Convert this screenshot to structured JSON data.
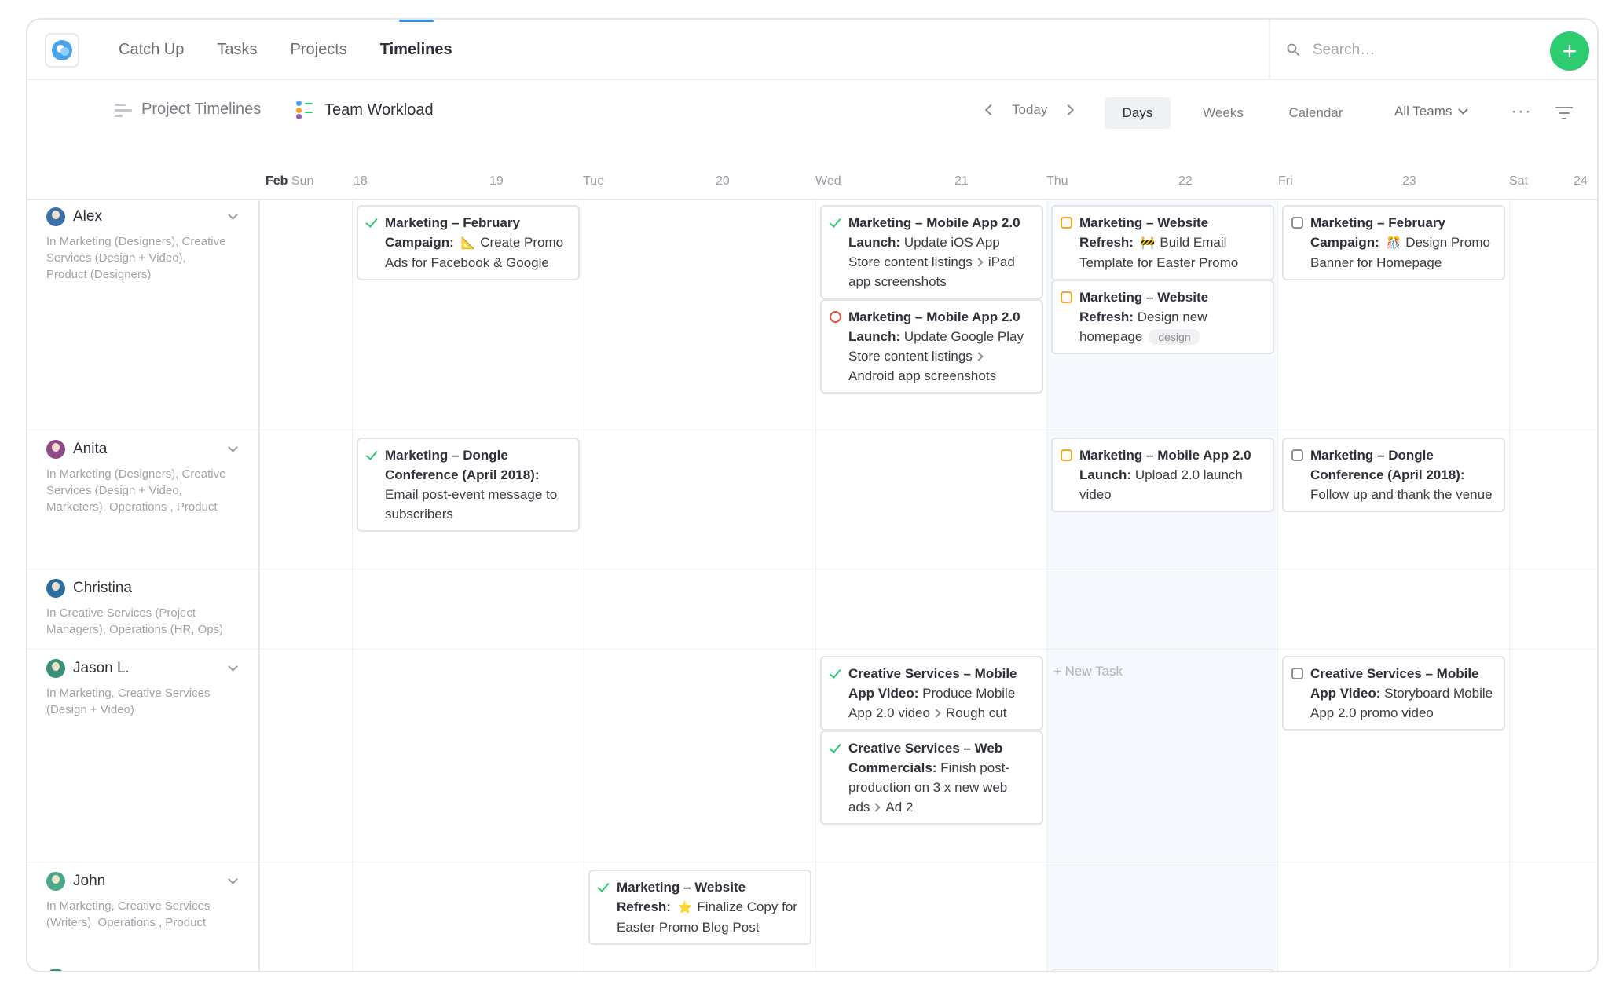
{
  "nav": {
    "items": [
      "Catch Up",
      "Tasks",
      "Projects",
      "Timelines"
    ],
    "active": "Timelines"
  },
  "search": {
    "placeholder": "Search…"
  },
  "add_button": "+",
  "views": {
    "project_timelines": "Project Timelines",
    "team_workload": "Team Workload"
  },
  "pager": {
    "today": "Today"
  },
  "ranges": {
    "days": "Days",
    "weeks": "Weeks",
    "calendar": "Calendar"
  },
  "teams_filter": "All Teams",
  "more": "···",
  "calendar_header": {
    "month": "Feb",
    "days": [
      {
        "weekday": "Sun",
        "date": "18"
      },
      {
        "weekday": "Tue",
        "date": "19"
      },
      {
        "weekday": "",
        "date": "20"
      },
      {
        "weekday": "Wed",
        "date": "21"
      },
      {
        "weekday": "Thu",
        "date": "22"
      },
      {
        "weekday": "Fri",
        "date": "23"
      },
      {
        "weekday": "Sat",
        "date": "24"
      }
    ]
  },
  "people": [
    {
      "name": "Alex",
      "teams": "In Marketing (Designers), Creative Services (Design + Video), Product (Designers)",
      "avatar_color": "#3d6fa8"
    },
    {
      "name": "Anita",
      "teams": "In Marketing (Designers), Creative Services (Design + Video, Marketers), Operations , Product",
      "avatar_color": "#8e4b8a"
    },
    {
      "name": "Christina",
      "teams": "In Creative Services (Project Managers), Operations (HR, Ops)",
      "avatar_color": "#2c6d9e"
    },
    {
      "name": "Jason L.",
      "teams": "In Marketing, Creative Services (Design + Video)",
      "avatar_color": "#3a8f76"
    },
    {
      "name": "John",
      "teams": "In Marketing, Creative Services (Writers), Operations , Product",
      "avatar_color": "#4aa88a"
    }
  ],
  "tasks": {
    "alex_1": {
      "project": "Marketing – February Campaign:",
      "emoji": "📐",
      "text": "Create Promo Ads for Facebook & Google"
    },
    "alex_2": {
      "project": "Marketing – Mobile App 2.0 Launch:",
      "text": "Update iOS App Store content listings",
      "sub": "iPad app screenshots"
    },
    "alex_3": {
      "project": "Marketing – Mobile App 2.0 Launch:",
      "text": "Update Google Play Store content listings",
      "sub": "Android app screenshots"
    },
    "alex_4": {
      "project": "Marketing – Website Refresh:",
      "emoji": "🚧",
      "text": "Build Email Template for Easter Promo"
    },
    "alex_5": {
      "project": "Marketing – Website Refresh:",
      "text": "Design new homepage",
      "tag": "design"
    },
    "alex_6": {
      "project": "Marketing – February Campaign:",
      "emoji": "🎊",
      "text": "Design Promo Banner for Homepage"
    },
    "anita_1": {
      "project": "Marketing – Dongle Conference (April 2018):",
      "text": "Email post-event message to subscribers"
    },
    "anita_2": {
      "project": "Marketing – Mobile App 2.0 Launch:",
      "text": "Upload 2.0 launch video"
    },
    "anita_3": {
      "project": "Marketing – Dongle Conference (April 2018):",
      "text": "Follow up and thank the venue"
    },
    "jason_1": {
      "project": "Creative Services – Mobile App Video:",
      "text": "Produce Mobile App 2.0 video",
      "sub": "Rough cut"
    },
    "jason_2": {
      "project": "Creative Services – Web Commercials:",
      "text": "Finish post-production on 3 x new web ads",
      "sub": "Ad 2"
    },
    "jason_3": {
      "project": "Creative Services – Mobile App Video:",
      "text": "Storyboard Mobile App 2.0 promo video"
    },
    "john_1": {
      "project": "Marketing – Website Refresh:",
      "emoji": "⭐",
      "text": "Finalize Copy for Easter Promo Blog Post"
    }
  },
  "new_task": "+ New Task"
}
